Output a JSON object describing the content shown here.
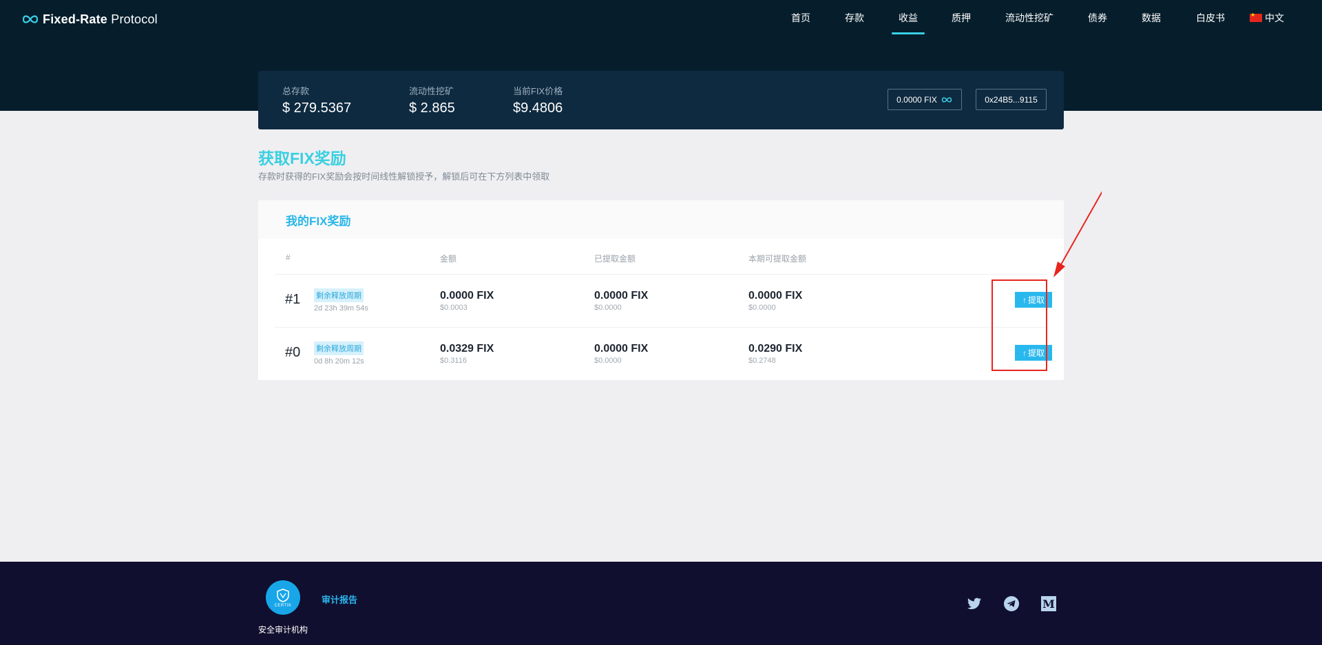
{
  "app": {
    "logo_bold": "Fixed-Rate",
    "logo_light": " Protocol",
    "logo_icon": "infinity-icon"
  },
  "nav": {
    "items": [
      {
        "label": "首页"
      },
      {
        "label": "存款"
      },
      {
        "label": "收益",
        "active": true
      },
      {
        "label": "质押"
      },
      {
        "label": "流动性挖矿"
      },
      {
        "label": "债券"
      },
      {
        "label": "数据"
      },
      {
        "label": "白皮书"
      }
    ],
    "language": "中文"
  },
  "stats": {
    "total_deposit": {
      "label": "总存款",
      "value": "$ 279.5367"
    },
    "liquidity_mining": {
      "label": "流动性挖矿",
      "value": "$ 2.865"
    },
    "fix_price": {
      "label": "当前FIX价格",
      "value": "$9.4806"
    },
    "fix_balance": "0.0000 FIX",
    "wallet_address": "0x24B5...9115"
  },
  "rewards_section": {
    "title": "获取FIX奖励",
    "subtitle": "存款时获得的FIX奖励会按时间线性解锁授予，解锁后可在下方列表中领取"
  },
  "rewards_table": {
    "card_title": "我的FIX奖励",
    "columns": [
      "#",
      "金额",
      "已提取金额",
      "本期可提取金额"
    ],
    "rows": [
      {
        "index": "#1",
        "tag": "剩余释放周期",
        "countdown": "2d 23h 39m 54s",
        "amount": "0.0000 FIX",
        "amount_usd": "$0.0003",
        "withdrawn": "0.0000 FIX",
        "withdrawn_usd": "$0.0000",
        "claimable": "0.0000 FIX",
        "claimable_usd": "$0.0000",
        "action": "提取"
      },
      {
        "index": "#0",
        "tag": "剩余释放周期",
        "countdown": "0d 8h 20m 12s",
        "amount": "0.0329 FIX",
        "amount_usd": "$0.3116",
        "withdrawn": "0.0000 FIX",
        "withdrawn_usd": "$0.0000",
        "claimable": "0.0290 FIX",
        "claimable_usd": "$0.2748",
        "action": "提取"
      }
    ]
  },
  "footer": {
    "auditor_name": "CERTIK",
    "audit_link": "审计报告",
    "audit_org_label": "安全审计机构",
    "social_icons": [
      "twitter-icon",
      "telegram-icon",
      "medium-icon"
    ]
  },
  "colors": {
    "header_bg": "#061e2c",
    "accent": "#3ad0e0",
    "button": "#29b8ee",
    "annotation": "#e8241d",
    "footer_bg": "#100f2f"
  }
}
